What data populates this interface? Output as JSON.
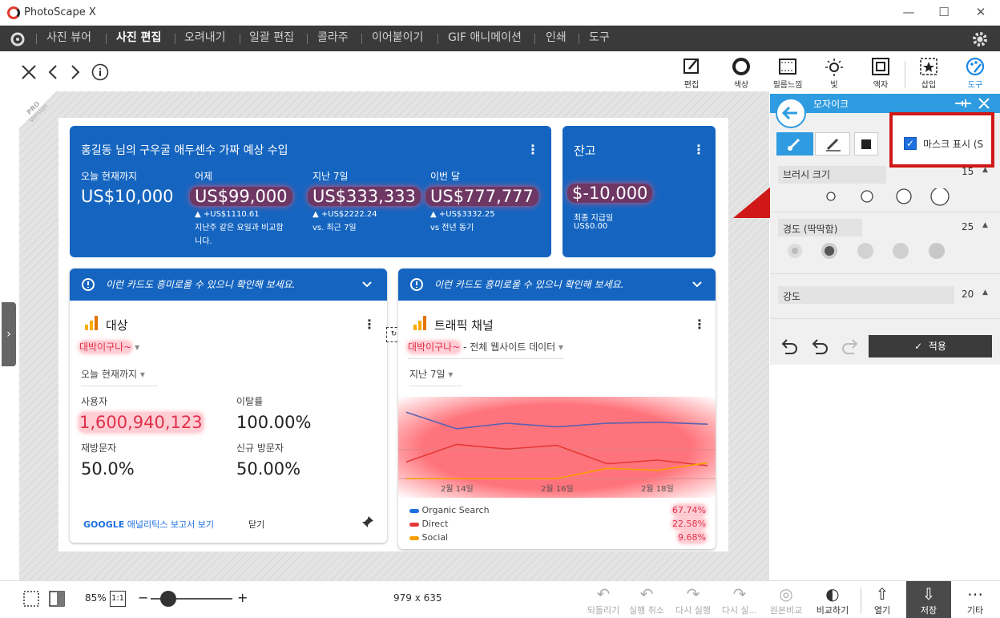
{
  "window": {
    "title": "PhotoScape X",
    "minimize": "—",
    "maximize": "☐",
    "close": "✕"
  },
  "menu": {
    "tabs": [
      "사진 뷰어",
      "사진 편집",
      "오려내기",
      "일괄 편집",
      "콜라주",
      "이어붙이기",
      "GIF 애니메이션",
      "인쇄",
      "도구"
    ],
    "active_index": 1
  },
  "toolbar": {
    "tools": [
      "편집",
      "색상",
      "필름느낌",
      "빛",
      "액자",
      "삽입",
      "도구"
    ],
    "active": "도구"
  },
  "watermark": {
    "line1": "PRO",
    "line2": "Version"
  },
  "report": {
    "income_card": {
      "title": "홍길동 님의 구우굴 애두센수 가짜 예상 수입",
      "cols": [
        {
          "label": "오늘 현재까지",
          "value": "US$10,000",
          "d1": "",
          "d2": "",
          "d3": ""
        },
        {
          "label": "어제",
          "value": "US$99,000",
          "d1": "▲ +US$1110.61",
          "d2": "지난주 같은 요일과 비교합",
          "d3": "니다."
        },
        {
          "label": "지난 7일",
          "value": "US$333,333",
          "d1": "▲ +US$2222.24",
          "d2": "vs. 최근 7일",
          "d3": ""
        },
        {
          "label": "이번 달",
          "value": "US$777,777",
          "d1": "▲ +US$3332.25",
          "d2": "vs 전년 동기",
          "d3": ""
        }
      ]
    },
    "balance_card": {
      "title": "잔고",
      "value": "$-10,000",
      "sub1": "최종 지급일",
      "sub2": "US$0.00"
    },
    "notice": "이런 카드도 흥미로울 수 있으니 확인해 보세요.",
    "audience": {
      "title": "대상",
      "property": "대박이구나~",
      "range": "오늘 현재까지",
      "m1_label": "사용자",
      "m1_value": "1,600,940,123",
      "m2_label": "이탈률",
      "m2_value": "100.00%",
      "m3_label": "재방문자",
      "m3_value": "50.0%",
      "m4_label": "신규 방문자",
      "m4_value": "50.00%",
      "link_bold": "GOOGLE",
      "link_rest": " 애널리틱스 보고서 보기",
      "close": "닫기"
    },
    "traffic": {
      "title": "트래픽 채널",
      "property": "대박이구나~",
      "property_rest": " - 전체 웹사이트 데이터",
      "range": "지난 7일",
      "xticks": [
        "2월 14일",
        "2월 16일",
        "2월 18일"
      ],
      "legend": [
        {
          "name": "Organic Search",
          "value": "67.74%",
          "color": "#1e6fe0"
        },
        {
          "name": "Direct",
          "value": "22.58%",
          "color": "#e53935"
        },
        {
          "name": "Social",
          "value": "9.68%",
          "color": "#f59f00"
        }
      ]
    }
  },
  "chart_data": {
    "type": "line",
    "x": [
      "2월 13일",
      "2월 14일",
      "2월 15일",
      "2월 16일",
      "2월 17일",
      "2월 18일",
      "2월 19일"
    ],
    "series": [
      {
        "name": "Organic Search",
        "values": [
          3.6,
          2.7,
          3.0,
          2.8,
          3.0,
          3.05,
          2.95
        ],
        "color": "#5c5fb0"
      },
      {
        "name": "Direct",
        "values": [
          0.9,
          1.85,
          1.6,
          1.8,
          0.8,
          1.0,
          0.7
        ],
        "color": "#e53935"
      },
      {
        "name": "Social",
        "values": [
          0,
          0,
          0,
          0,
          0.55,
          0.45,
          0.85
        ],
        "color": "#f59f00"
      }
    ],
    "ylim": [
      0,
      4
    ]
  },
  "panel": {
    "title": "모자이크",
    "mask_label": "마스크 표시 (S",
    "brush_label": "브러시 크기",
    "brush_value": "15",
    "hard_label": "경도 (딱딱함)",
    "hard_value": "25",
    "strength_label": "강도",
    "strength_value": "20",
    "apply": "적용"
  },
  "status": {
    "zoom": "85%",
    "oneone": "1:1",
    "dims": "979 x 635",
    "buttons": [
      "되돌리기",
      "실행 취소",
      "다시 실행",
      "다시 실...",
      "원본비교",
      "비교하기",
      "열기",
      "저장",
      "기타"
    ]
  }
}
